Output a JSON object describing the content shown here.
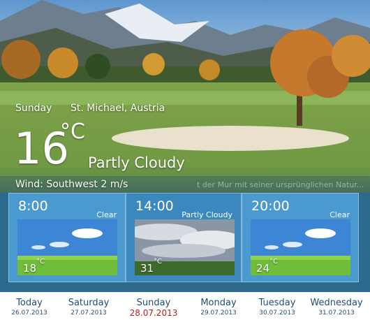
{
  "current": {
    "day": "Sunday",
    "location": "St. Michael, Austria",
    "temperature": "16",
    "unit": "°C",
    "condition": "Partly Cloudy",
    "wind": "Wind: Southwest  2 m/s",
    "ticker": "t der Mur mit seiner ursprünglichen Natur..."
  },
  "forecast": [
    {
      "time": "8:00",
      "condition": "Clear",
      "temperature": "18",
      "unit": "°C",
      "icon": "clear-sky-image"
    },
    {
      "time": "14:00",
      "condition": "Partly Cloudy",
      "temperature": "31",
      "unit": "°C",
      "icon": "partly-cloudy-image"
    },
    {
      "time": "20:00",
      "condition": "Clear",
      "temperature": "24",
      "unit": "°C",
      "icon": "clear-sky-image"
    }
  ],
  "days": [
    {
      "name": "Today",
      "date": "26.07.2013"
    },
    {
      "name": "Saturday",
      "date": "27.07.2013"
    },
    {
      "name": "Sunday",
      "date": "28.07.2013",
      "selected": true
    },
    {
      "name": "Monday",
      "date": "29.07.2013"
    },
    {
      "name": "Tuesday",
      "date": "30.07.2013"
    },
    {
      "name": "Wednesday",
      "date": "31.07.2013"
    }
  ],
  "colors": {
    "panel": "#2e6a8e",
    "slot": "#4a9ad0",
    "selected_date": "#b81f1f",
    "day_text": "#1f4e70"
  }
}
